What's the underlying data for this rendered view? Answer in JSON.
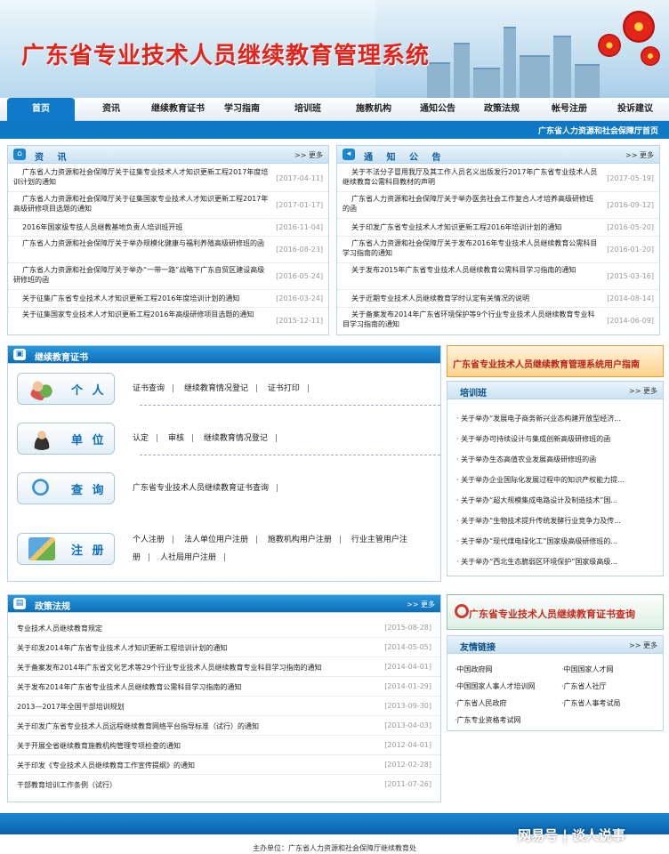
{
  "header": {
    "title": "广东省专业技术人员继续教育管理系统"
  },
  "nav": {
    "items": [
      "首页",
      "资讯",
      "继续教育证书",
      "学习指南",
      "培训班",
      "施教机构",
      "通知公告",
      "政策法规",
      "帐号注册",
      "投诉建议"
    ],
    "active_index": 0
  },
  "subbar": {
    "text": "广东省人力资源和社会保障厅首页"
  },
  "news": {
    "title": "资 讯",
    "more": ">> 更多",
    "items": [
      {
        "text": "广东省人力资源和社会保障厅关于征集专业技术人才知识更新工程2017年度培训计划的通知",
        "date": "[2017-04-11]"
      },
      {
        "text": "广东省人力资源和社会保障厅关于征集国家专业技术人才知识更新工程2017年高级研修项目选题的通知",
        "date": "[2017-01-17]"
      },
      {
        "text": "2016年国家级专技人员继教基地负责人培训班开班",
        "date": "[2016-11-04]"
      },
      {
        "text": "广东省人力资源和社会保障厅关于举办规模化健康与福利养殖高级研修班的函",
        "date": "[2016-08-23]"
      },
      {
        "text": "广东省人力资源和社会保障厅关于举办“一带一路”战略下广东自贸区建设高级研修班的函",
        "date": "[2016-05-24]"
      },
      {
        "text": "关于征集广东省专业技术人才知识更新工程2016年度培训计划的通知",
        "date": "[2016-03-24]"
      },
      {
        "text": "关于征集国家专业技术人才知识更新工程2016年高级研修项目选题的通知",
        "date": "[2015-12-11]"
      }
    ]
  },
  "notices": {
    "title": "通 知 公 告",
    "more": ">> 更多",
    "items": [
      {
        "text": "关于不法分子冒用我厅及其工作人员名义出版发行2017年广东省专业技术人员继续教育公需科目教材的声明",
        "date": "[2017-05-19]"
      },
      {
        "text": "广东省人力资源和社会保障厅关于举办医务社会工作复合人才培养高级研修班的函",
        "date": "[2016-09-12]"
      },
      {
        "text": "关于印发广东省专业技术人才知识更新工程2016年培训计划的通知",
        "date": "[2016-05-20]"
      },
      {
        "text": "广东省人力资源和社会保障厅关于发布2016年专业技术人员继续教育公需科目学习指南的通知",
        "date": "[2016-01-20]"
      },
      {
        "text": "关于发布2015年广东省专业技术人员继续教育公需科目学习指南的通知",
        "date": "[2015-03-16]"
      },
      {
        "text": "关于近期专业技术人员继续教育学时认定有关情况的说明",
        "date": "[2014-08-14]"
      },
      {
        "text": "关于备案发布2014年广东省环境保护等9个行业专业技术人员继续教育专业科目学习指南的通知",
        "date": "[2014-06-09]"
      }
    ]
  },
  "cert": {
    "title": "继续教育证书",
    "rows": [
      {
        "label": "个 人",
        "links": [
          "证书查询",
          "继续教育情况登记",
          "证书打印"
        ]
      },
      {
        "label": "单 位",
        "links": [
          "认定",
          "审核",
          "继续教育情况登记"
        ]
      },
      {
        "label": "查 询",
        "links": [
          "广东省专业技术人员继续教育证书查询"
        ]
      },
      {
        "label": "注 册",
        "links": [
          "个人注册",
          "法人单位用户注册",
          "施教机构用户注册",
          "行业主管用户注册",
          "人社局用户注册"
        ]
      }
    ]
  },
  "policy": {
    "title": "政策法规",
    "more": ">> 更多",
    "items": [
      {
        "text": "专业技术人员继续教育规定",
        "date": "[2015-08-28]"
      },
      {
        "text": "关于印发2014年广东省专业技术人才知识更新工程培训计划的通知",
        "date": "[2014-05-05]"
      },
      {
        "text": "关于备案发布2014年广东省文化艺术等29个行业专业技术人员继续教育专业科目学习指南的通知",
        "date": "[2014-04-01]"
      },
      {
        "text": "关于发布2014年广东省专业技术人员继续教育公需科目学习指南的通知",
        "date": "[2014-01-29]"
      },
      {
        "text": "2013—2017年全国干部培训规划",
        "date": "[2013-09-30]"
      },
      {
        "text": "关于印发广东省专业技术人员远程继续教育网络平台指导标准（试行）的通知",
        "date": "[2013-04-03]"
      },
      {
        "text": "关于开展全省继续教育施教机构管理专项检查的通知",
        "date": "[2012-04-01]"
      },
      {
        "text": "关于印发《专业技术人员继续教育工作宣传提纲》的通知",
        "date": "[2012-02-28]"
      },
      {
        "text": "干部教育培训工作条例（试行）",
        "date": "[2011-07-26]"
      }
    ]
  },
  "guide_banner": {
    "text": "广东省专业技术人员继续教育管理系统用户指南"
  },
  "training": {
    "title": "培训班",
    "more": ">> 更多",
    "items": [
      "· 关于举办“发展电子商务新兴业态构建开放型经济...",
      "· 关于举办可持续设计与集成创新高级研修班的函",
      "· 关于举办生态高值农业发展高级研修班的函",
      "· 关于举办企业国际化发展过程中的知识产权能力提...",
      "· 关于举办“超大规模集成电路设计及制造技术”国...",
      "· 关于举办“生物技术提升传统发酵行业竞争力及传...",
      "· 关于举办“现代煤电绿化工”国家级高级研修班的...",
      "· 关于举办“西北生态脆弱区环境保护”国家级高级..."
    ]
  },
  "cert_query_banner": {
    "text": "广东省专业技术人员继续教育证书查询"
  },
  "friends": {
    "title": "友情链接",
    "more": ">> 更多",
    "items": [
      "·中国政府网",
      "·中国国家人才网",
      "·中国国家人事人才培训网",
      "·广东省人社厅",
      "·广东省人民政府",
      "·广东省人事考试局",
      "·广东专业资格考试网"
    ]
  },
  "footer": {
    "text": "主办单位：广东省人力资源和社会保障厅继续教育处"
  },
  "watermark": {
    "text": "网易号 | 谈人说事"
  }
}
